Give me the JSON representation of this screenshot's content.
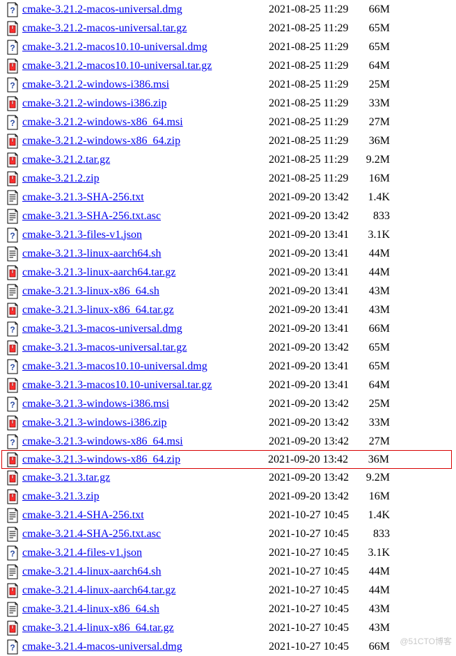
{
  "watermark": "@51CTO博客",
  "icons": {
    "archive": "archive",
    "unknown": "unknown",
    "text": "text"
  },
  "files": [
    {
      "name": "cmake-3.21.2-macos-universal.dmg",
      "date": "2021-08-25 11:29",
      "size": "66M",
      "icon": "unknown",
      "highlight": false
    },
    {
      "name": "cmake-3.21.2-macos-universal.tar.gz",
      "date": "2021-08-25 11:29",
      "size": "65M",
      "icon": "archive",
      "highlight": false
    },
    {
      "name": "cmake-3.21.2-macos10.10-universal.dmg",
      "date": "2021-08-25 11:29",
      "size": "65M",
      "icon": "unknown",
      "highlight": false
    },
    {
      "name": "cmake-3.21.2-macos10.10-universal.tar.gz",
      "date": "2021-08-25 11:29",
      "size": "64M",
      "icon": "archive",
      "highlight": false
    },
    {
      "name": "cmake-3.21.2-windows-i386.msi",
      "date": "2021-08-25 11:29",
      "size": "25M",
      "icon": "unknown",
      "highlight": false
    },
    {
      "name": "cmake-3.21.2-windows-i386.zip",
      "date": "2021-08-25 11:29",
      "size": "33M",
      "icon": "archive",
      "highlight": false
    },
    {
      "name": "cmake-3.21.2-windows-x86_64.msi",
      "date": "2021-08-25 11:29",
      "size": "27M",
      "icon": "unknown",
      "highlight": false
    },
    {
      "name": "cmake-3.21.2-windows-x86_64.zip",
      "date": "2021-08-25 11:29",
      "size": "36M",
      "icon": "archive",
      "highlight": false
    },
    {
      "name": "cmake-3.21.2.tar.gz",
      "date": "2021-08-25 11:29",
      "size": "9.2M",
      "icon": "archive",
      "highlight": false
    },
    {
      "name": "cmake-3.21.2.zip",
      "date": "2021-08-25 11:29",
      "size": "16M",
      "icon": "archive",
      "highlight": false
    },
    {
      "name": "cmake-3.21.3-SHA-256.txt",
      "date": "2021-09-20 13:42",
      "size": "1.4K",
      "icon": "text",
      "highlight": false
    },
    {
      "name": "cmake-3.21.3-SHA-256.txt.asc",
      "date": "2021-09-20 13:42",
      "size": "833",
      "icon": "text",
      "highlight": false
    },
    {
      "name": "cmake-3.21.3-files-v1.json",
      "date": "2021-09-20 13:41",
      "size": "3.1K",
      "icon": "unknown",
      "highlight": false
    },
    {
      "name": "cmake-3.21.3-linux-aarch64.sh",
      "date": "2021-09-20 13:41",
      "size": "44M",
      "icon": "text",
      "highlight": false
    },
    {
      "name": "cmake-3.21.3-linux-aarch64.tar.gz",
      "date": "2021-09-20 13:41",
      "size": "44M",
      "icon": "archive",
      "highlight": false
    },
    {
      "name": "cmake-3.21.3-linux-x86_64.sh",
      "date": "2021-09-20 13:41",
      "size": "43M",
      "icon": "text",
      "highlight": false
    },
    {
      "name": "cmake-3.21.3-linux-x86_64.tar.gz",
      "date": "2021-09-20 13:41",
      "size": "43M",
      "icon": "archive",
      "highlight": false
    },
    {
      "name": "cmake-3.21.3-macos-universal.dmg",
      "date": "2021-09-20 13:41",
      "size": "66M",
      "icon": "unknown",
      "highlight": false
    },
    {
      "name": "cmake-3.21.3-macos-universal.tar.gz",
      "date": "2021-09-20 13:42",
      "size": "65M",
      "icon": "archive",
      "highlight": false
    },
    {
      "name": "cmake-3.21.3-macos10.10-universal.dmg",
      "date": "2021-09-20 13:41",
      "size": "65M",
      "icon": "unknown",
      "highlight": false
    },
    {
      "name": "cmake-3.21.3-macos10.10-universal.tar.gz",
      "date": "2021-09-20 13:41",
      "size": "64M",
      "icon": "archive",
      "highlight": false
    },
    {
      "name": "cmake-3.21.3-windows-i386.msi",
      "date": "2021-09-20 13:42",
      "size": "25M",
      "icon": "unknown",
      "highlight": false
    },
    {
      "name": "cmake-3.21.3-windows-i386.zip",
      "date": "2021-09-20 13:42",
      "size": "33M",
      "icon": "archive",
      "highlight": false
    },
    {
      "name": "cmake-3.21.3-windows-x86_64.msi",
      "date": "2021-09-20 13:42",
      "size": "27M",
      "icon": "unknown",
      "highlight": false
    },
    {
      "name": "cmake-3.21.3-windows-x86_64.zip",
      "date": "2021-09-20 13:42",
      "size": "36M",
      "icon": "archive",
      "highlight": true
    },
    {
      "name": "cmake-3.21.3.tar.gz",
      "date": "2021-09-20 13:42",
      "size": "9.2M",
      "icon": "archive",
      "highlight": false
    },
    {
      "name": "cmake-3.21.3.zip",
      "date": "2021-09-20 13:42",
      "size": "16M",
      "icon": "archive",
      "highlight": false
    },
    {
      "name": "cmake-3.21.4-SHA-256.txt",
      "date": "2021-10-27 10:45",
      "size": "1.4K",
      "icon": "text",
      "highlight": false
    },
    {
      "name": "cmake-3.21.4-SHA-256.txt.asc",
      "date": "2021-10-27 10:45",
      "size": "833",
      "icon": "text",
      "highlight": false
    },
    {
      "name": "cmake-3.21.4-files-v1.json",
      "date": "2021-10-27 10:45",
      "size": "3.1K",
      "icon": "unknown",
      "highlight": false
    },
    {
      "name": "cmake-3.21.4-linux-aarch64.sh",
      "date": "2021-10-27 10:45",
      "size": "44M",
      "icon": "text",
      "highlight": false
    },
    {
      "name": "cmake-3.21.4-linux-aarch64.tar.gz",
      "date": "2021-10-27 10:45",
      "size": "44M",
      "icon": "archive",
      "highlight": false
    },
    {
      "name": "cmake-3.21.4-linux-x86_64.sh",
      "date": "2021-10-27 10:45",
      "size": "43M",
      "icon": "text",
      "highlight": false
    },
    {
      "name": "cmake-3.21.4-linux-x86_64.tar.gz",
      "date": "2021-10-27 10:45",
      "size": "43M",
      "icon": "archive",
      "highlight": false
    },
    {
      "name": "cmake-3.21.4-macos-universal.dmg",
      "date": "2021-10-27 10:45",
      "size": "66M",
      "icon": "unknown",
      "highlight": false
    }
  ]
}
